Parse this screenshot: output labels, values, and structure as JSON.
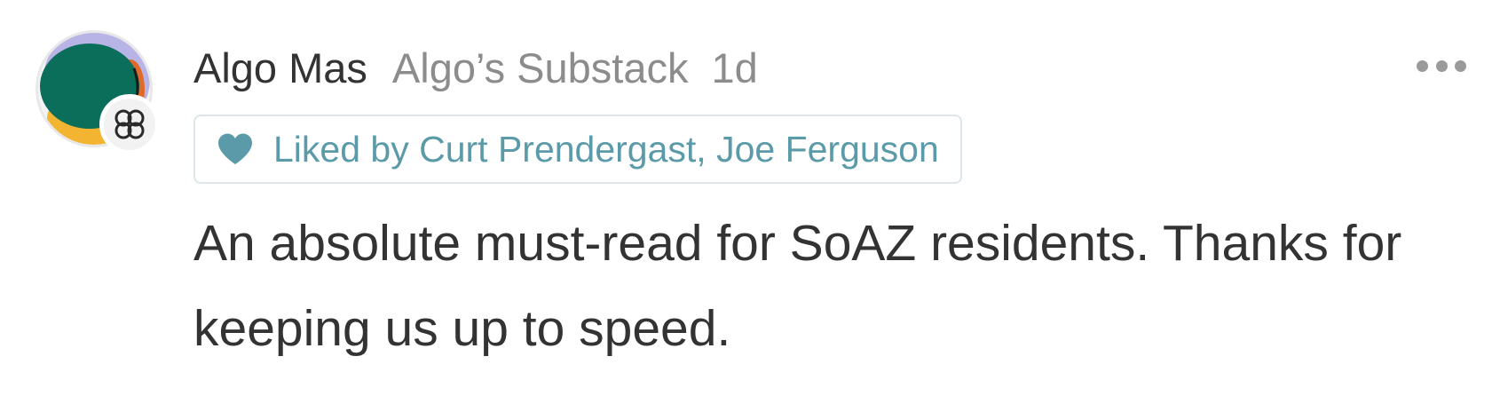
{
  "comment": {
    "author": {
      "name": "Algo Mas",
      "publication": "Algo’s Substack",
      "avatar": "avatar-image",
      "badge_icon": "publication-badge-icon"
    },
    "timestamp": "1d",
    "more_icon": "more-horizontal-icon",
    "likes": {
      "icon": "heart-icon",
      "label": "Liked by Curt Prendergast, Joe Ferguson",
      "color": "#5b9aa8"
    },
    "body": "An absolute must-read for SoAZ residents. Thanks for keeping us up to speed."
  },
  "colors": {
    "avatar_green": "#0b6e5a",
    "avatar_lavender": "#b8b4e6",
    "avatar_orange": "#e06a2a",
    "avatar_yellow": "#f3b431",
    "secondary_text": "#8c8c8c",
    "primary_text": "#333333"
  }
}
